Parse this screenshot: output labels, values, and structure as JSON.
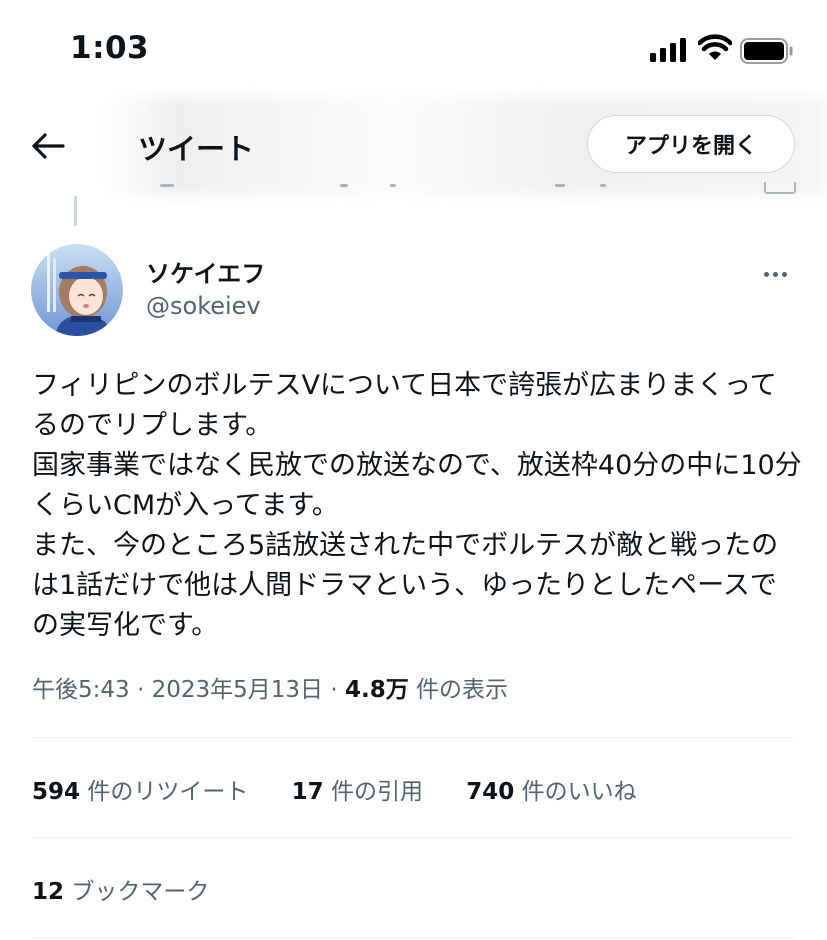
{
  "status_bar": {
    "time": "1:03"
  },
  "header": {
    "title": "ツイート",
    "open_app_label": "アプリを開く"
  },
  "tweet": {
    "author_name": "ソケイエフ",
    "author_handle": "@sokeiev",
    "text": "フィリピンのボルテスVについて日本で誇張が広まりまくってるのでリプします。\n国家事業ではなく民放での放送なので、放送枠40分の中に10分くらいCMが入ってます。\nまた、今のところ5話放送された中でボルテスが敵と戦ったのは1話だけで他は人間ドラマという、ゆったりとしたペースでの実写化です。",
    "time": "午後5:43",
    "date": "2023年5月13日",
    "views_count": "4.8万",
    "views_label": "件の表示",
    "separator": "·"
  },
  "stats": {
    "retweets_count": "594",
    "retweets_label": "件のリツイート",
    "quotes_count": "17",
    "quotes_label": "件の引用",
    "likes_count": "740",
    "likes_label": "件のいいね",
    "bookmarks_count": "12",
    "bookmarks_label": "ブックマーク"
  },
  "colors": {
    "text": "#0f1419",
    "secondary": "#536471",
    "border": "#cfd9de",
    "divider": "#eff3f4"
  },
  "icons": [
    "cellular-signal-icon",
    "wifi-icon",
    "battery-icon",
    "back-arrow-icon",
    "more-options-icon"
  ]
}
